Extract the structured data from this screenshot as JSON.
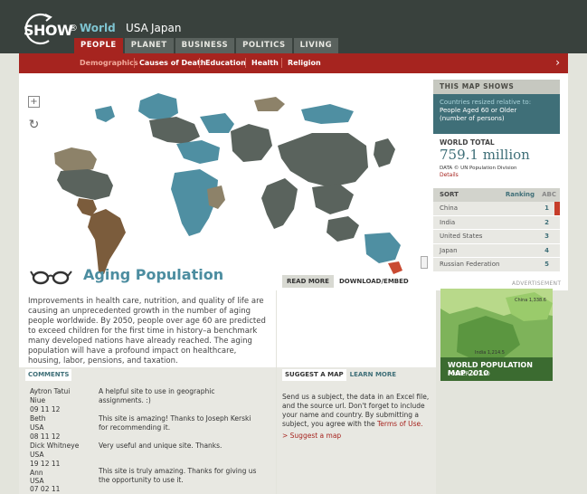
{
  "header": {
    "logo_text": "SHOW",
    "logo_mark": "®",
    "logo_world": "World",
    "links": [
      "USA",
      "Japan"
    ],
    "tabs": [
      {
        "label": "PEOPLE",
        "active": true
      },
      {
        "label": "PLANET",
        "active": false
      },
      {
        "label": "BUSINESS",
        "active": false
      },
      {
        "label": "POLITICS",
        "active": false
      },
      {
        "label": "LIVING",
        "active": false
      }
    ]
  },
  "subnav": {
    "items": [
      {
        "label": "Demographics",
        "active": true
      },
      {
        "label": "Causes of Death",
        "active": false
      },
      {
        "label": "Education",
        "active": false
      },
      {
        "label": "Health",
        "active": false
      },
      {
        "label": "Religion",
        "active": false
      }
    ],
    "next_icon": "chevron-right-icon"
  },
  "map": {
    "controls": [
      {
        "icon": "zoom-in-icon",
        "glyph": "+"
      },
      {
        "icon": "reset-icon",
        "glyph": "↻"
      }
    ],
    "title": "Aging Population",
    "title_icon": "glasses-icon",
    "colors": {
      "teal": "#4f8fa2",
      "dark": "#5a635d",
      "brown": "#7b5c3c",
      "khaki": "#8d8269",
      "red": "#c94a32"
    }
  },
  "panel": {
    "header": "THIS MAP SHOWS",
    "desc_label": "Countries resized relative to:",
    "desc_value": "People Aged 60 or Older",
    "desc_unit": "(number of persons)",
    "total_label": "WORLD TOTAL",
    "total_value": "759.1 million",
    "source": "DATA © UN Population Division",
    "details": "Details",
    "sort_label": "SORT",
    "sort_ranking": "Ranking",
    "sort_abc": "ABC",
    "rows": [
      {
        "country": "China",
        "rank": "1"
      },
      {
        "country": "India",
        "rank": "2"
      },
      {
        "country": "United States",
        "rank": "3"
      },
      {
        "country": "Japan",
        "rank": "4"
      },
      {
        "country": "Russian Federation",
        "rank": "5"
      }
    ]
  },
  "tabs2": [
    {
      "label": "READ MORE",
      "active": true
    },
    {
      "label": "DOWNLOAD/EMBED",
      "active": false
    }
  ],
  "advertisement": "ADVERTISEMENT",
  "description": "Improvements in health care, nutrition, and quality of life are causing an unprecedented growth in the number of aging people worldwide. By 2050, people over age 60 are predicted to exceed children for the first time in history–a benchmark many developed nations have already reached. The aging population will have a profound impact on healthcare, housing, labor, pensions, and taxation.",
  "poster": {
    "title": "WORLD POPULATION MAP 2010",
    "price": "POSTER, € 7.50",
    "labels": [
      "China 1,338.6",
      "India 1,214.5"
    ]
  },
  "comments_tab": "COMMENTS",
  "comments": [
    {
      "name": "Aytron Tatui",
      "country": "Niue",
      "date": "09 11 12",
      "text": "A helpful site to use in geographic assignments. :)"
    },
    {
      "name": "Beth",
      "country": "USA",
      "date": "08 11 12",
      "text": "This site is amazing! Thanks to Joseph Kerski for recommending it."
    },
    {
      "name": "Dick Whitneye",
      "country": "USA",
      "date": "19 12 11",
      "text": "Very useful and unique site. Thanks."
    },
    {
      "name": "Ann",
      "country": "USA",
      "date": "07 02 11",
      "text": "This site is truly amazing. Thanks for giving us the opportunity to use it."
    }
  ],
  "suggest_tabs": [
    {
      "label": "SUGGEST A MAP",
      "active": true
    },
    {
      "label": "LEARN MORE",
      "active": false
    }
  ],
  "suggest": {
    "text": "Send us a subject, the data in an Excel file, and the source url. Don't forget to include your name and country. By submitting a subject, you agree with the",
    "terms": "Terms of Use.",
    "link": "> Suggest a map"
  }
}
